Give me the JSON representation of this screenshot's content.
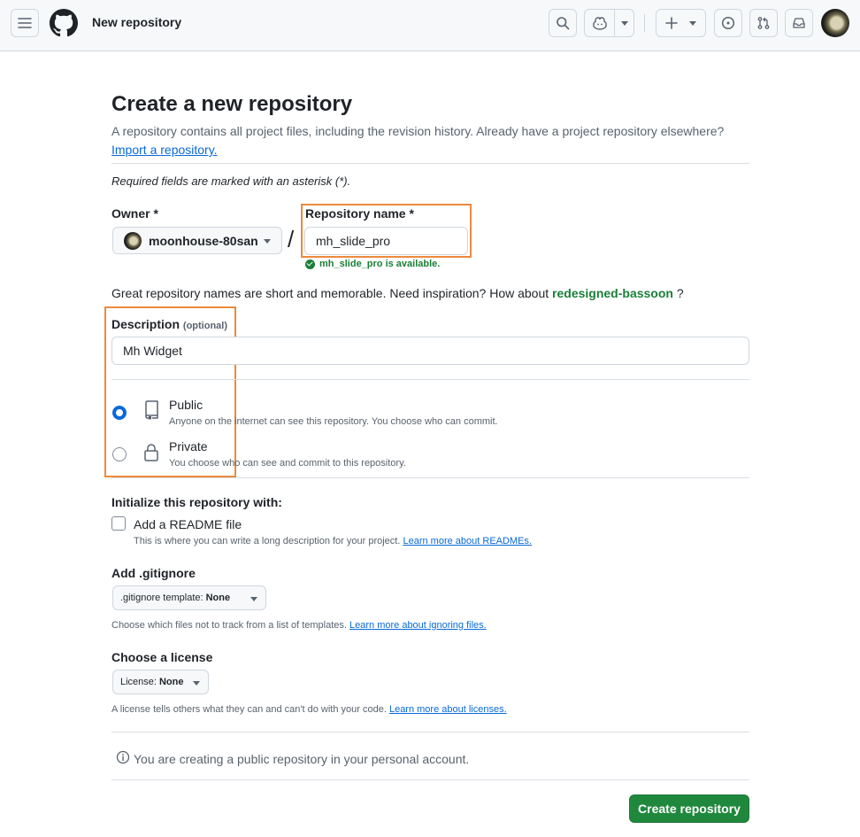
{
  "header": {
    "context_title": "New repository",
    "icons": [
      "menu-icon",
      "github-logo-icon",
      "search-icon",
      "copilot-icon",
      "chevron-down-icon",
      "plus-icon",
      "issues-icon",
      "pull-requests-icon",
      "inbox-icon",
      "avatar"
    ]
  },
  "page": {
    "title": "Create a new repository",
    "subtitle": "A repository contains all project files, including the revision history. Already have a project repository elsewhere?",
    "import_link": "Import a repository.",
    "required_note": "Required fields are marked with an asterisk (*)."
  },
  "owner": {
    "label": "Owner *",
    "value": "moonhouse-80san"
  },
  "repo_name": {
    "label": "Repository name *",
    "value": "mh_slide_pro",
    "availability": "mh_slide_pro is available."
  },
  "suggestion": {
    "text": "Great repository names are short and memorable. Need inspiration? How about",
    "name": "redesigned-bassoon",
    "suffix": "?"
  },
  "description": {
    "label": "Description",
    "optional": "(optional)",
    "value": "Mh Widget"
  },
  "visibility": {
    "selected": "Public",
    "options": [
      {
        "title": "Public",
        "desc": "Anyone on the internet can see this repository. You choose who can commit."
      },
      {
        "title": "Private",
        "desc": "You choose who can see and commit to this repository."
      }
    ]
  },
  "init": {
    "heading": "Initialize this repository with:",
    "readme_label": "Add a README file",
    "readme_desc": "This is where you can write a long description for your project.",
    "readme_link": "Learn more about READMEs.",
    "readme_checked": false
  },
  "gitignore": {
    "heading": "Add .gitignore",
    "button_prefix": ".gitignore template:",
    "button_value": "None",
    "desc": "Choose which files not to track from a list of templates.",
    "link": "Learn more about ignoring files."
  },
  "license": {
    "heading": "Choose a license",
    "button_prefix": "License:",
    "button_value": "None",
    "desc": "A license tells others what they can and can't do with your code.",
    "link": "Learn more about licenses."
  },
  "info_note": "You are creating a public repository in your personal account.",
  "submit_label": "Create repository",
  "colors": {
    "accent_green": "#1f883d",
    "link_blue": "#0969da",
    "highlight_orange": "#ed8a3d",
    "success_green": "#1a7f37"
  }
}
